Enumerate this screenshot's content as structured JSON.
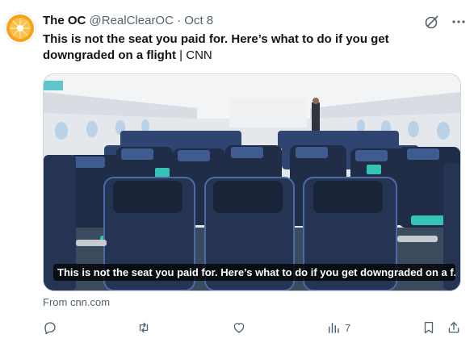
{
  "tweet": {
    "display_name": "The OC",
    "handle": "@RealClearOC",
    "separator": "·",
    "date": "Oct 8",
    "text_headline": "This is not the seat you paid for. Here’s what to do if you get downgraded on a flight",
    "text_suffix": " | CNN",
    "media_caption": "This is not the seat you paid for. Here’s what to do if you get downgraded on a f...",
    "source": "From cnn.com",
    "views_count": "7"
  },
  "icons": {
    "avatar": "orange-slice-avatar",
    "grok": "grok-icon",
    "more": "more-icon",
    "reply": "reply-icon",
    "retweet": "retweet-icon",
    "like": "heart-icon",
    "views": "views-icon",
    "bookmark": "bookmark-icon",
    "share": "share-icon"
  },
  "colors": {
    "text": "#0f1419",
    "secondary": "#536471",
    "avatar_orange": "#f7a21b"
  }
}
